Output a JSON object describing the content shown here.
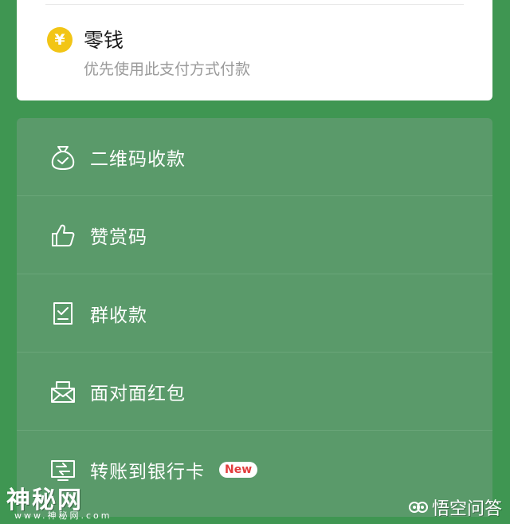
{
  "payment": {
    "title": "零钱",
    "subtitle": "优先使用此支付方式付款",
    "icon": "yen-coin-icon",
    "icon_glyph": "¥"
  },
  "menu": {
    "items": [
      {
        "label": "二维码收款",
        "icon": "money-bag-check-icon"
      },
      {
        "label": "赞赏码",
        "icon": "thumbs-up-icon"
      },
      {
        "label": "群收款",
        "icon": "group-collect-icon"
      },
      {
        "label": "面对面红包",
        "icon": "red-packet-icon"
      },
      {
        "label": "转账到银行卡",
        "icon": "bank-transfer-icon",
        "badge": "New"
      }
    ]
  },
  "watermarks": {
    "left_text": "神秘网",
    "left_url": "www.神秘网.com",
    "right_text": "悟空问答"
  },
  "colors": {
    "background": "#3f9652",
    "menu_card": "#5a9a6a",
    "yen": "#f2c516",
    "badge_text": "#e23d3d"
  }
}
